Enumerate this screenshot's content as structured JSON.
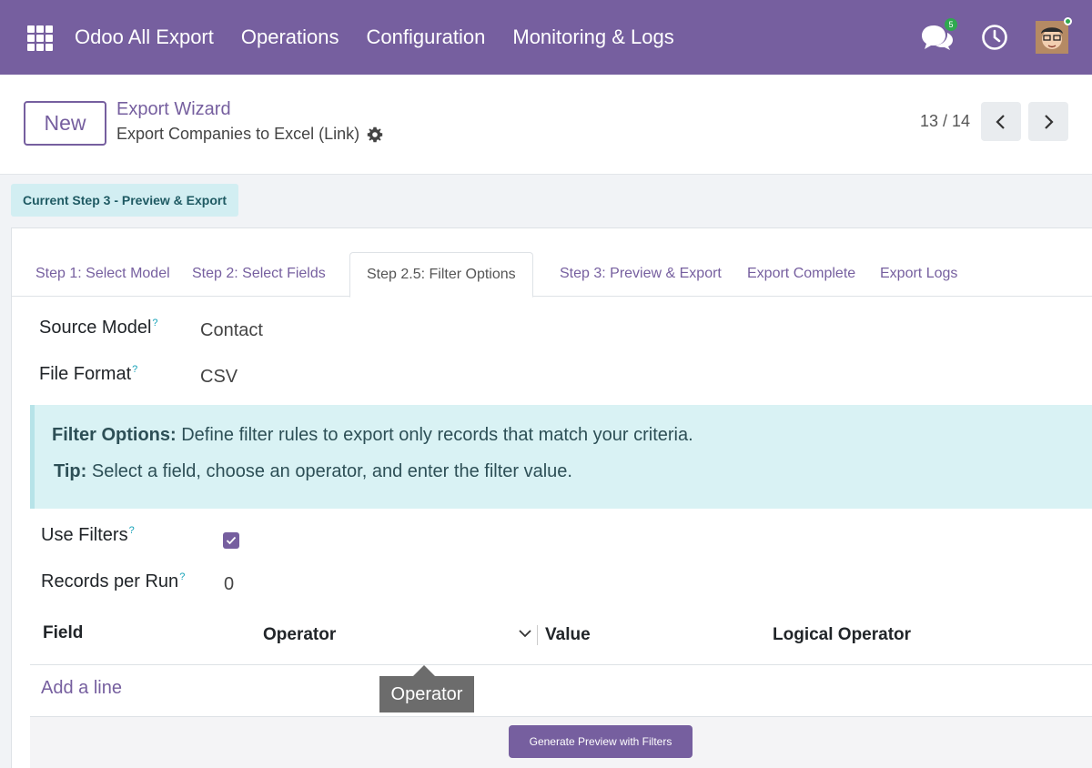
{
  "navbar": {
    "app_name": "Odoo All Export",
    "menu": [
      "Operations",
      "Configuration",
      "Monitoring & Logs"
    ],
    "chat_badge": "5"
  },
  "control": {
    "new_label": "New",
    "breadcrumb": "Export Wizard",
    "record_title": "Export Companies to Excel (Link)",
    "pager": "13 / 14"
  },
  "status": "Current Step 3 - Preview & Export",
  "tabs": [
    "Step 1: Select Model",
    "Step 2: Select Fields",
    "Step 2.5: Filter Options",
    "Step 3: Preview & Export",
    "Export Complete",
    "Export Logs"
  ],
  "active_tab": "Step 2.5: Filter Options",
  "fields": {
    "source_model_label": "Source Model",
    "source_model_value": "Contact",
    "file_format_label": "File Format",
    "file_format_value": "CSV",
    "use_filters_label": "Use Filters",
    "use_filters_checked": true,
    "records_per_run_label": "Records per Run",
    "records_per_run_value": "0",
    "help_mark": "?"
  },
  "alert": {
    "line1_bold": "Filter Options:",
    "line1_text": " Define filter rules to export only records that match your criteria.",
    "line2_bold": "Tip:",
    "line2_text": " Select a field, choose an operator, and enter the filter value."
  },
  "table": {
    "columns": [
      "Field",
      "Operator",
      "Value",
      "Logical Operator"
    ],
    "add_line": "Add a line"
  },
  "tooltip": "Operator",
  "generate_button": "Generate Preview with Filters",
  "colors": {
    "brand": "#765f9f",
    "info_bg": "#d9f2f4",
    "status_bg": "#d2eef2"
  }
}
